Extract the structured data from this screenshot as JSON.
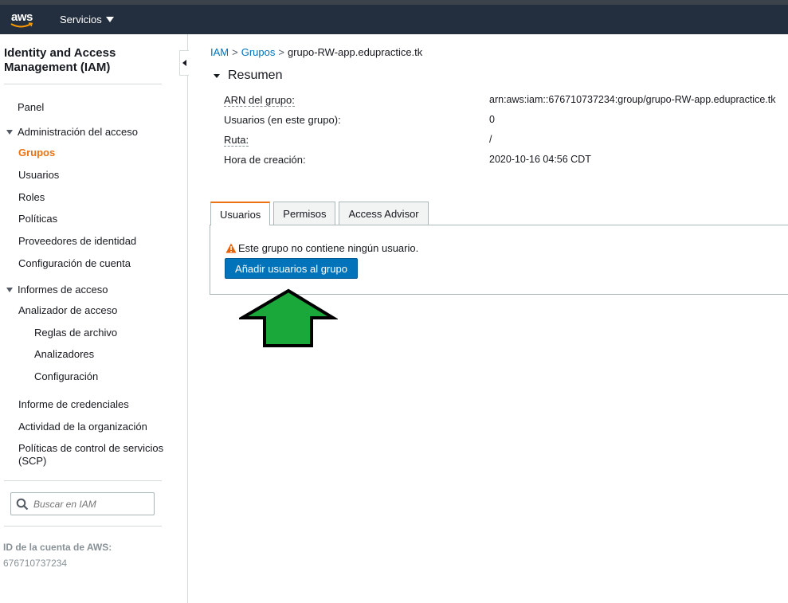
{
  "topnav": {
    "brand": "aws",
    "services_label": "Servicios"
  },
  "sidebar": {
    "title": "Identity and Access Management (IAM)",
    "panel": "Panel",
    "access_mgmt": {
      "label": "Administración del acceso",
      "items": [
        "Grupos",
        "Usuarios",
        "Roles",
        "Políticas",
        "Proveedores de identidad",
        "Configuración de cuenta"
      ],
      "active": "Grupos"
    },
    "access_reports": {
      "label": "Informes de acceso",
      "items": [
        "Analizador de acceso",
        "Reglas de archivo",
        "Analizadores",
        "Configuración",
        "Informe de credenciales",
        "Actividad de la organización",
        "Políticas de control de servicios (SCP)"
      ]
    },
    "search_placeholder": "Buscar en IAM",
    "account_label": "ID de la cuenta de AWS:",
    "account_id": "676710737234"
  },
  "breadcrumb": {
    "root": "IAM",
    "sep": ">",
    "groups": "Grupos",
    "current": "grupo-RW-app.edupractice.tk"
  },
  "summary": {
    "heading": "Resumen",
    "rows": [
      {
        "label": "ARN del grupo:",
        "value": "arn:aws:iam::676710737234:group/grupo-RW-app.edupractice.tk"
      },
      {
        "label": "Usuarios (en este grupo):",
        "value": "0"
      },
      {
        "label": "Ruta:",
        "value": "/"
      },
      {
        "label": "Hora de creación:",
        "value": "2020-10-16 04:56 CDT"
      }
    ]
  },
  "tabs": [
    "Usuarios",
    "Permisos",
    "Access Advisor"
  ],
  "panel": {
    "warning": "Este grupo no contiene ningún usuario.",
    "add_button": "Añadir usuarios al grupo"
  },
  "colors": {
    "accent": "#ec7211",
    "link": "#0073bb",
    "button": "#0073bb",
    "arrow": "#1aa83a",
    "nav": "#232f3e"
  }
}
